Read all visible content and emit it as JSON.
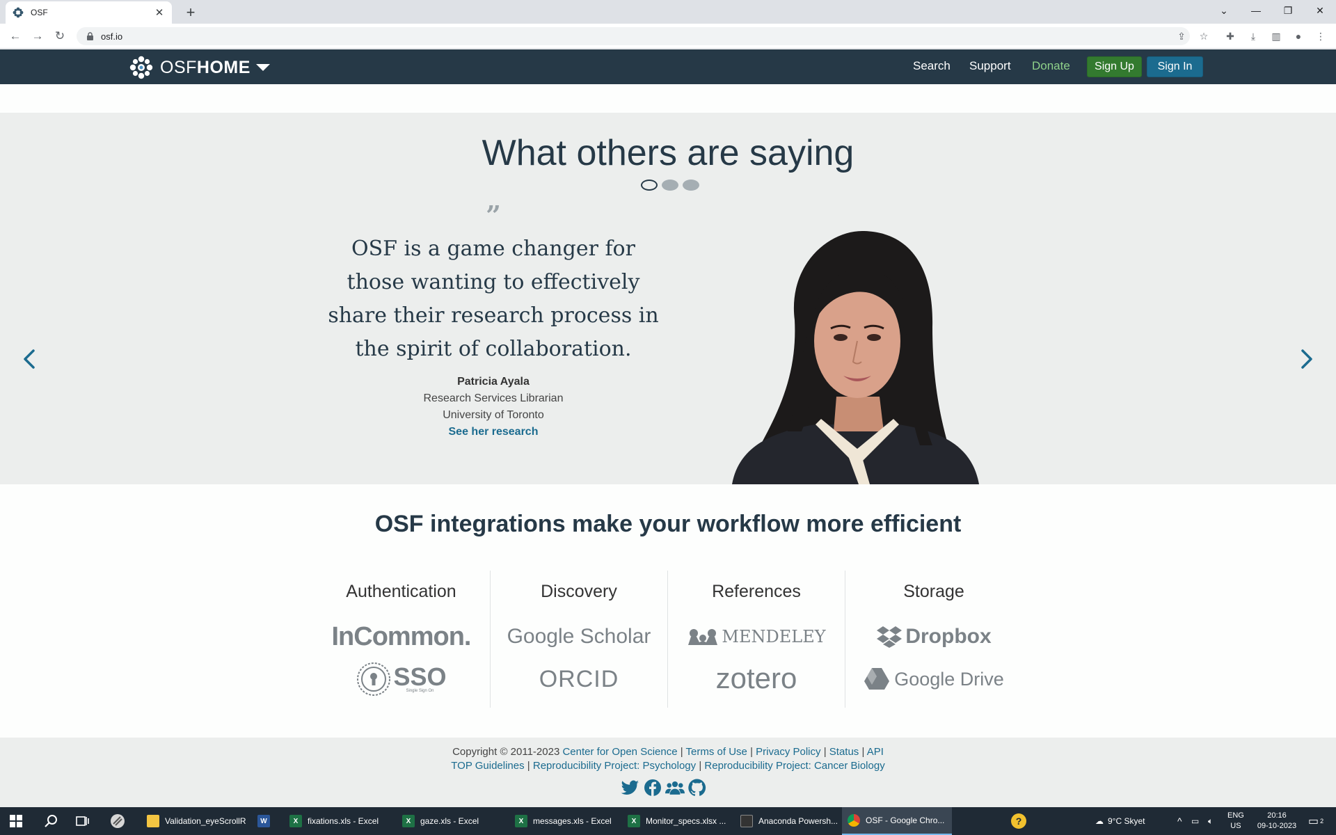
{
  "browser": {
    "tab_title": "OSF",
    "url": "osf.io",
    "new_tab_label": "+",
    "tab_close_label": "✕"
  },
  "nav": {
    "brand_osf": "OSF",
    "brand_home": "HOME",
    "links": [
      "Search",
      "Support",
      "Donate"
    ],
    "signup_label": "Sign Up",
    "signin_label": "Sign In",
    "donate_color": "#8fd18a",
    "bg_color": "#263947"
  },
  "testimonial": {
    "heading": "What others are saying",
    "quote": "OSF is a game changer for those wanting to effectively share their research process in the spirit of collaboration.",
    "name": "Patricia Ayala",
    "role": "Research Services Librarian",
    "org": "University of Toronto",
    "link": "See her research",
    "slides": 3,
    "active_slide": 1
  },
  "integrations": {
    "heading": "OSF integrations make your workflow more efficient",
    "columns": [
      {
        "title": "Authentication",
        "logos": [
          "InCommon.",
          "SSO",
          "Single Sign On"
        ]
      },
      {
        "title": "Discovery",
        "logos": [
          "Google Scholar",
          "ORCID"
        ]
      },
      {
        "title": "References",
        "logos": [
          "MENDELEY",
          "zotero"
        ]
      },
      {
        "title": "Storage",
        "logos": [
          "Dropbox",
          "Google Drive"
        ]
      }
    ]
  },
  "footer": {
    "copyright": "Copyright © 2011-2023",
    "cos": "Center for Open Science",
    "terms": "Terms of Use",
    "privacy": "Privacy Policy",
    "status": "Status",
    "api": "API",
    "top": "TOP Guidelines",
    "rp_psych": "Reproducibility Project: Psychology",
    "rp_cancer": "Reproducibility Project: Cancer Biology",
    "sep": "|"
  },
  "taskbar": {
    "apps": [
      {
        "label": "Validation_eyeScrollR",
        "icon": "folder-icon"
      },
      {
        "label": "",
        "icon": "word-icon"
      },
      {
        "label": "fixations.xls - Excel",
        "icon": "excel-icon"
      },
      {
        "label": "gaze.xls - Excel",
        "icon": "excel-icon"
      },
      {
        "label": "messages.xls - Excel",
        "icon": "excel-icon"
      },
      {
        "label": "Monitor_specs.xlsx ...",
        "icon": "excel-icon"
      },
      {
        "label": "Anaconda Powersh...",
        "icon": "terminal-icon"
      },
      {
        "label": "OSF - Google Chro...",
        "icon": "chrome-icon"
      }
    ],
    "weather": "9°C  Skyet",
    "lang": "ENG",
    "region": "US",
    "time": "20:16",
    "date": "09-10-2023",
    "notif_count": "2"
  }
}
